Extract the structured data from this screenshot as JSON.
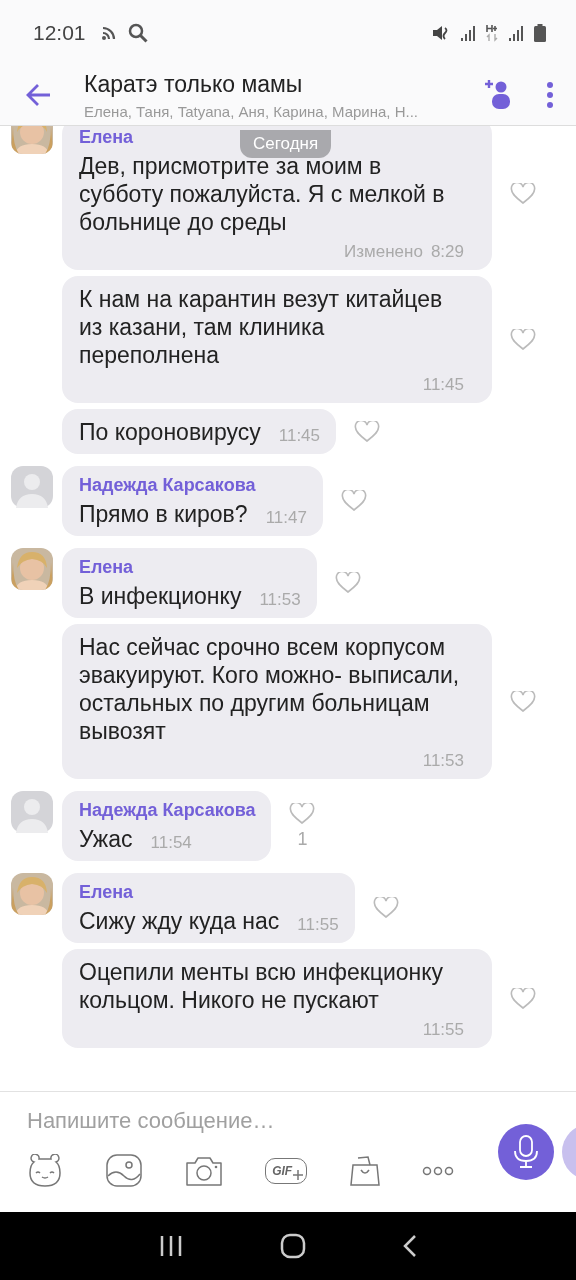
{
  "status_bar": {
    "time": "12:01"
  },
  "header": {
    "title": "Каратэ только мамы",
    "members": "Елена, Таня, Tatyana, Аня, Карина, Марина, Н..."
  },
  "date_pill": "Сегодня",
  "messages": [
    {
      "sender": "Елена",
      "text": "Дев, присмотрите за моим в субботу пожалуйста. Я с мелкой в больнице до среды",
      "time": "8:29",
      "edited": "Изменено",
      "wide": true,
      "liked": false
    },
    {
      "text": "К нам на карантин везут китайцев из казани, там клиника переполнена",
      "time": "11:45",
      "wide": true,
      "liked": false
    },
    {
      "text": "По короновирусу",
      "time": "11:45",
      "wide": false,
      "liked": false
    },
    {
      "sender": "Надежда Карсакова",
      "avatar": {
        "kind": "placeholder"
      },
      "text": "Прямо в киров?",
      "time": "11:47",
      "wide": false,
      "liked": false
    },
    {
      "sender": "Елена",
      "text": "В инфекционку",
      "time": "11:53",
      "wide": false,
      "liked": false
    },
    {
      "text": "Нас сейчас срочно всем корпусом эвакуируют. Кого можно- выписали, остальных по другим больницам вывозят",
      "time": "11:53",
      "wide": true,
      "liked": false
    },
    {
      "sender": "Надежда Карсакова",
      "avatar": {
        "kind": "placeholder"
      },
      "text": "Ужас",
      "time": "11:54",
      "wide": false,
      "liked": false,
      "likes": "1"
    },
    {
      "sender": "Елена",
      "text": "Сижу жду куда нас",
      "time": "11:55",
      "wide": false,
      "liked": false
    },
    {
      "text": "Оцепили менты всю инфекционку кольцом. Никого не пускают",
      "time": "11:55",
      "wide": true,
      "liked": false
    }
  ],
  "composer": {
    "placeholder": "Напишите сообщение…",
    "gif_label": "GIF"
  }
}
